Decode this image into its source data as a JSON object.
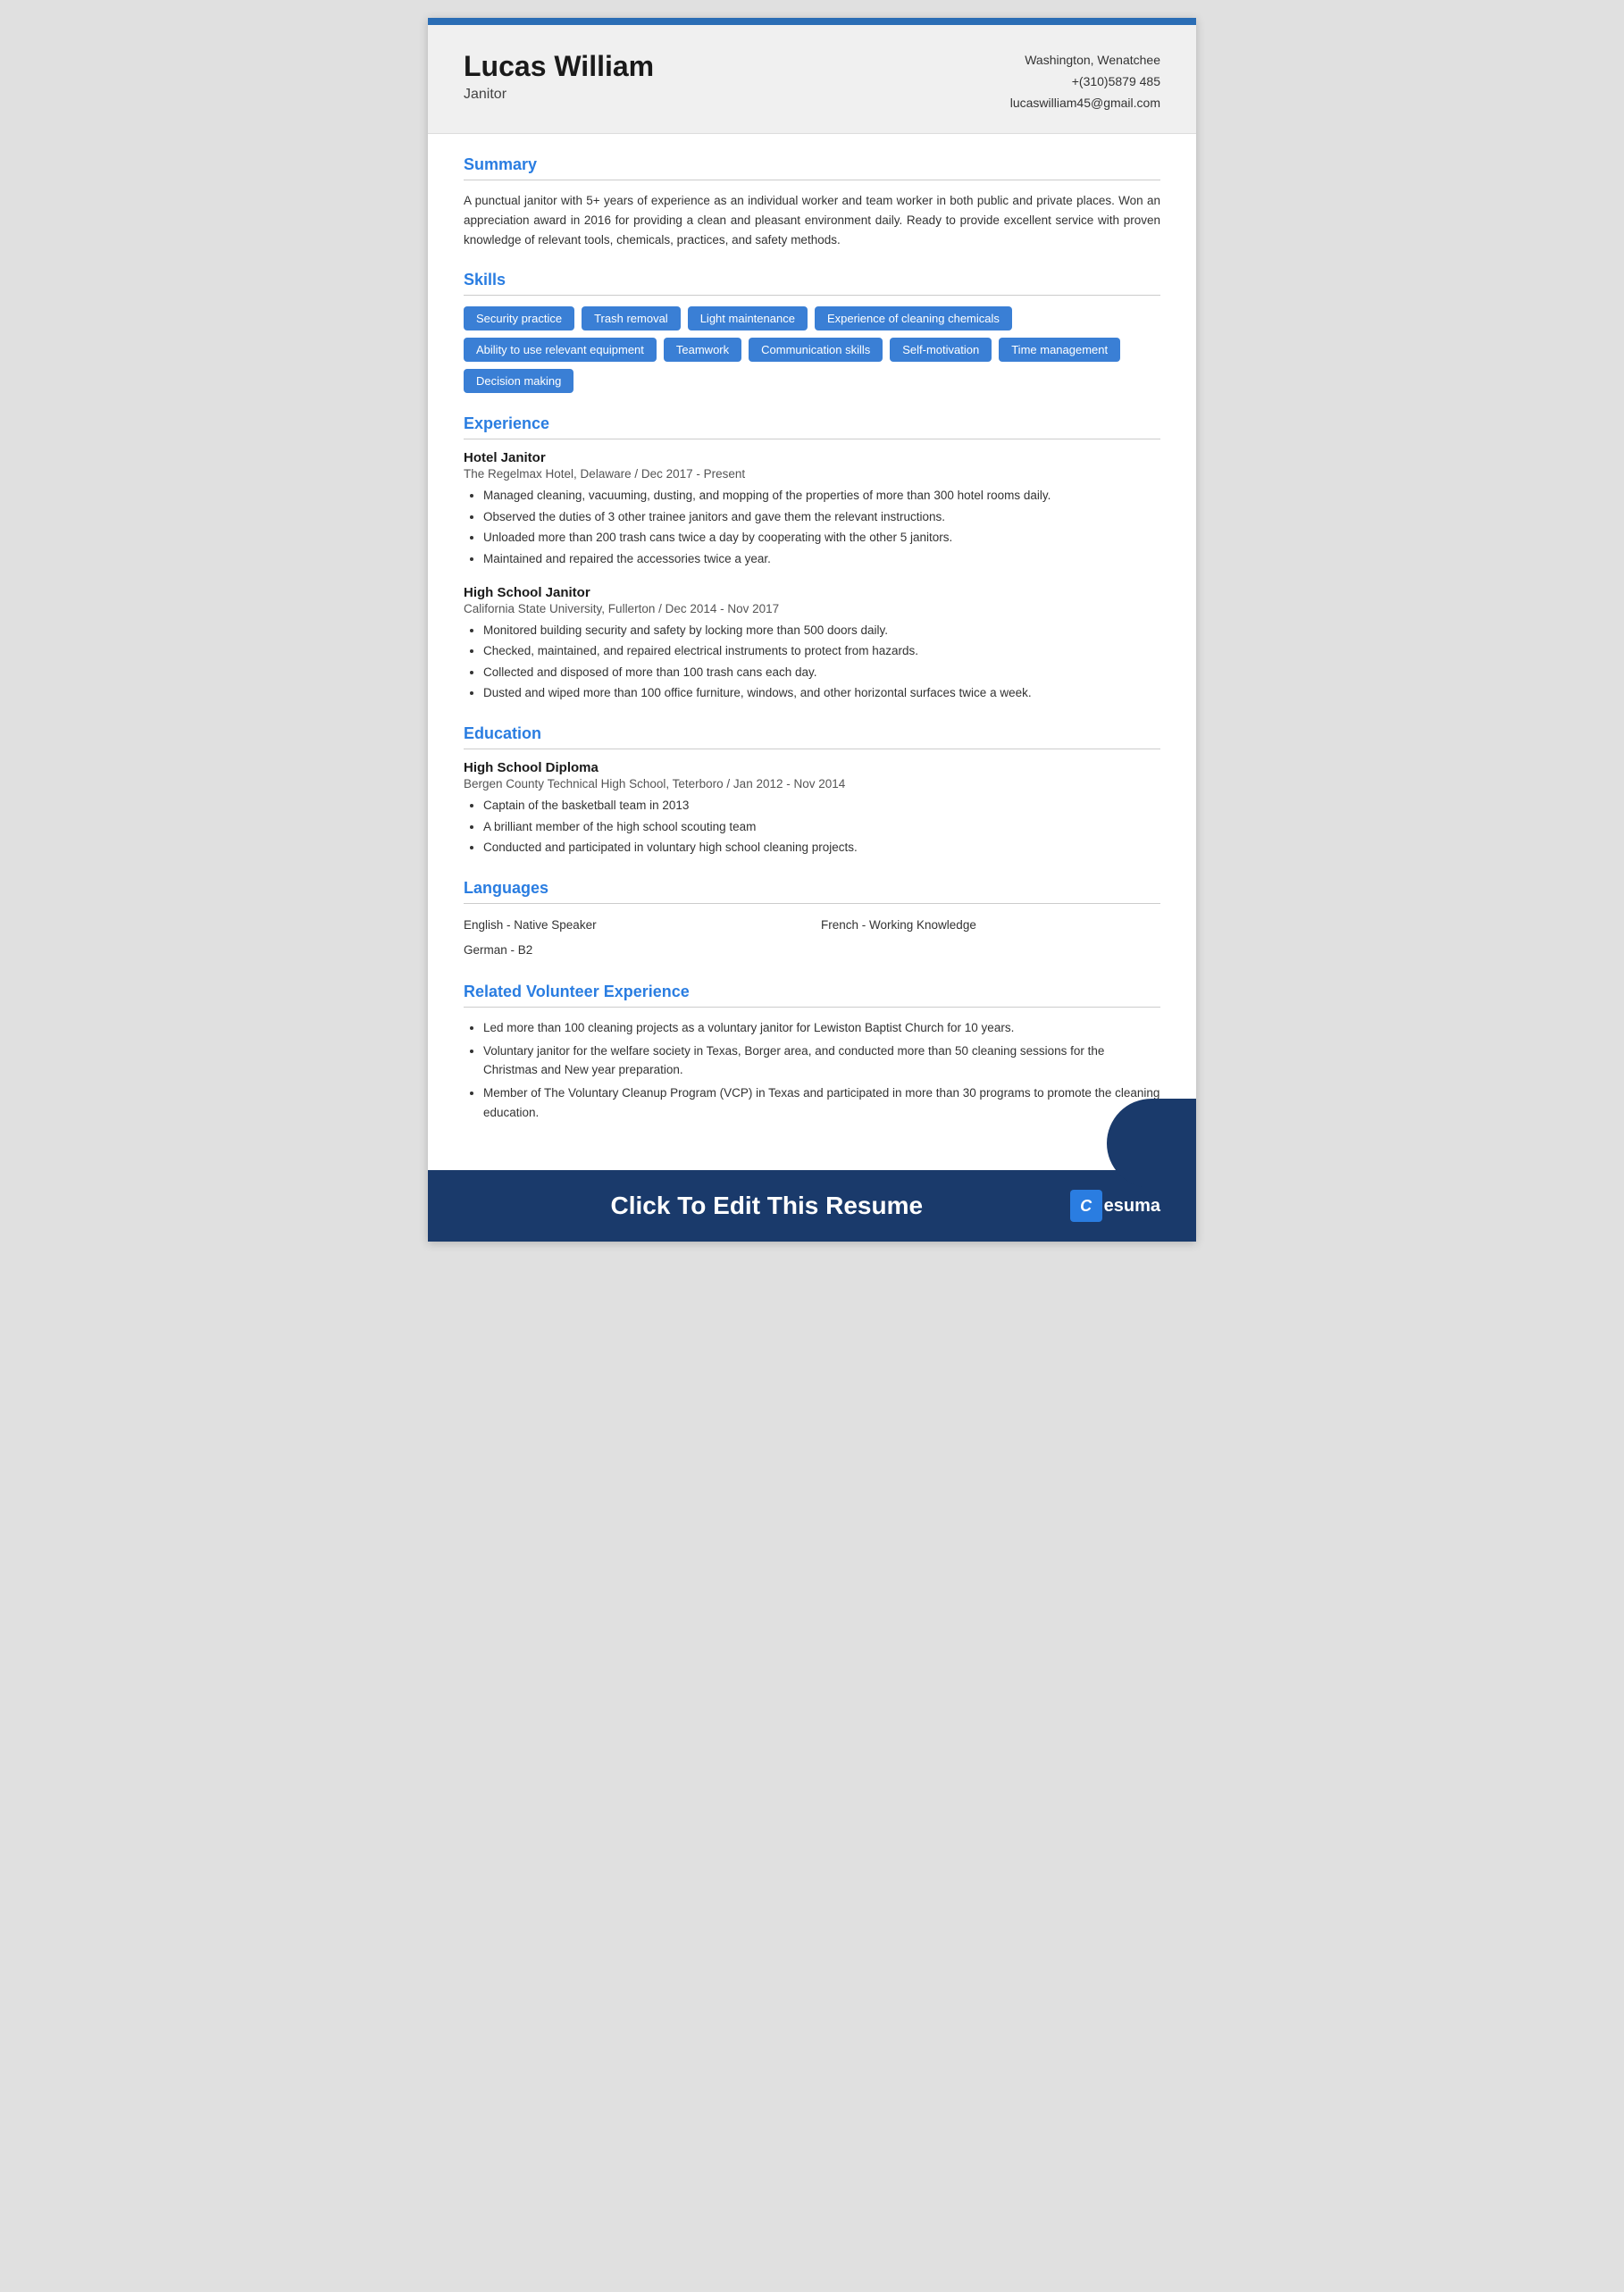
{
  "topBar": {},
  "header": {
    "name": "Lucas William",
    "jobTitle": "Janitor",
    "location": "Washington, Wenatchee",
    "phone": "+(310)5879 485",
    "email": "lucaswilliam45@gmail.com"
  },
  "sections": {
    "summary": {
      "title": "Summary",
      "text": "A punctual janitor with 5+ years of experience as an individual worker and team worker in both public and private places. Won an appreciation award in 2016 for providing a clean and pleasant environment daily. Ready to provide excellent service with proven knowledge of relevant tools, chemicals, practices, and safety methods."
    },
    "skills": {
      "title": "Skills",
      "tags": [
        "Security practice",
        "Trash removal",
        "Light maintenance",
        "Experience of cleaning chemicals",
        "Ability to use relevant equipment",
        "Teamwork",
        "Communication skills",
        "Self-motivation",
        "Time management",
        "Decision making"
      ]
    },
    "experience": {
      "title": "Experience",
      "items": [
        {
          "role": "Hotel Janitor",
          "company": "The Regelmax Hotel, Delaware / Dec 2017 - Present",
          "bullets": [
            "Managed cleaning, vacuuming, dusting, and mopping of the properties of more than 300 hotel rooms daily.",
            "Observed the duties of 3 other trainee janitors and gave them the relevant instructions.",
            "Unloaded more than 200 trash cans twice a day by cooperating with the other 5 janitors.",
            "Maintained and repaired the accessories twice a year."
          ]
        },
        {
          "role": "High School Janitor",
          "company": "California State University, Fullerton / Dec 2014 - Nov 2017",
          "bullets": [
            "Monitored building security and safety by locking more than 500 doors daily.",
            "Checked, maintained, and repaired electrical instruments to protect from hazards.",
            "Collected and disposed of more than 100 trash cans each day.",
            "Dusted and wiped more than 100 office furniture, windows, and other horizontal surfaces twice a week."
          ]
        }
      ]
    },
    "education": {
      "title": "Education",
      "items": [
        {
          "degree": "High School Diploma",
          "institution": "Bergen County Technical High School, Teterboro / Jan 2012 - Nov 2014",
          "bullets": [
            "Captain of the basketball team in 2013",
            "A brilliant member of the high school scouting team",
            "Conducted and participated in voluntary high school cleaning projects."
          ]
        }
      ]
    },
    "languages": {
      "title": "Languages",
      "items": [
        "English - Native Speaker",
        "French - Working Knowledge",
        "German - B2"
      ]
    },
    "volunteer": {
      "title": "Related Volunteer Experience",
      "bullets": [
        "Led more than 100 cleaning projects as a voluntary janitor for Lewiston Baptist Church for 10 years.",
        "Voluntary janitor for the welfare society in Texas, Borger area, and conducted more than 50 cleaning sessions for the Christmas and New year preparation.",
        "Member of The Voluntary Cleanup Program (VCP) in Texas and participated in more than 30 programs to promote the cleaning education."
      ]
    }
  },
  "cta": {
    "text": "Click To Edit This Resume",
    "logoChar": "C",
    "logoName": "esuma"
  }
}
